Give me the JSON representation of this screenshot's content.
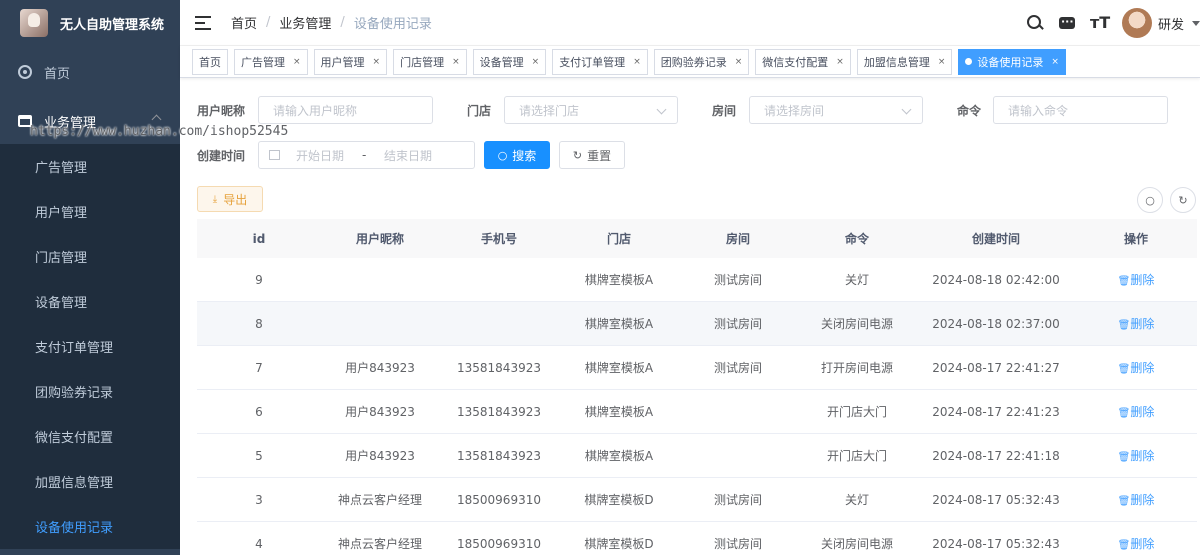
{
  "app": {
    "title": "无人自助管理系统"
  },
  "sidebar": {
    "home": "首页",
    "group": "业务管理",
    "items": [
      {
        "label": "广告管理",
        "active": false
      },
      {
        "label": "用户管理",
        "active": false
      },
      {
        "label": "门店管理",
        "active": false
      },
      {
        "label": "设备管理",
        "active": false
      },
      {
        "label": "支付订单管理",
        "active": false
      },
      {
        "label": "团购验券记录",
        "active": false
      },
      {
        "label": "微信支付配置",
        "active": false
      },
      {
        "label": "加盟信息管理",
        "active": false
      },
      {
        "label": "设备使用记录",
        "active": true
      }
    ]
  },
  "watermark": "https://www.huzhan.com/ishop52545",
  "breadcrumb": [
    "首页",
    "业务管理",
    "设备使用记录"
  ],
  "user": {
    "name": "研发"
  },
  "navbar": {
    "size_icon": "тT"
  },
  "tags": [
    {
      "label": "首页",
      "closable": false,
      "active": false
    },
    {
      "label": "广告管理",
      "closable": true,
      "active": false
    },
    {
      "label": "用户管理",
      "closable": true,
      "active": false
    },
    {
      "label": "门店管理",
      "closable": true,
      "active": false
    },
    {
      "label": "设备管理",
      "closable": true,
      "active": false
    },
    {
      "label": "支付订单管理",
      "closable": true,
      "active": false
    },
    {
      "label": "团购验券记录",
      "closable": true,
      "active": false
    },
    {
      "label": "微信支付配置",
      "closable": true,
      "active": false
    },
    {
      "label": "加盟信息管理",
      "closable": true,
      "active": false
    },
    {
      "label": "设备使用记录",
      "closable": true,
      "active": true
    }
  ],
  "form": {
    "nickname_label": "用户昵称",
    "nickname_placeholder": "请输入用户昵称",
    "store_label": "门店",
    "store_placeholder": "请选择门店",
    "room_label": "房间",
    "room_placeholder": "请选择房间",
    "command_label": "命令",
    "command_placeholder": "请输入命令",
    "created_label": "创建时间",
    "start_placeholder": "开始日期",
    "range_sep": "-",
    "end_placeholder": "结束日期",
    "search_label": "搜索",
    "reset_label": "重置",
    "export_label": "导出"
  },
  "table": {
    "columns": [
      "id",
      "用户昵称",
      "手机号",
      "门店",
      "房间",
      "命令",
      "创建时间",
      "操作"
    ],
    "delete_label": "删除",
    "rows": [
      {
        "id": "9",
        "nickname": "",
        "phone": "",
        "store": "棋牌室模板A",
        "room": "测试房间",
        "command": "关灯",
        "created": "2024-08-18 02:42:00",
        "hover": false
      },
      {
        "id": "8",
        "nickname": "",
        "phone": "",
        "store": "棋牌室模板A",
        "room": "测试房间",
        "command": "关闭房间电源",
        "created": "2024-08-18 02:37:00",
        "hover": true
      },
      {
        "id": "7",
        "nickname": "用户843923",
        "phone": "13581843923",
        "store": "棋牌室模板A",
        "room": "测试房间",
        "command": "打开房间电源",
        "created": "2024-08-17 22:41:27",
        "hover": false
      },
      {
        "id": "6",
        "nickname": "用户843923",
        "phone": "13581843923",
        "store": "棋牌室模板A",
        "room": "",
        "command": "开门店大门",
        "created": "2024-08-17 22:41:23",
        "hover": false
      },
      {
        "id": "5",
        "nickname": "用户843923",
        "phone": "13581843923",
        "store": "棋牌室模板A",
        "room": "",
        "command": "开门店大门",
        "created": "2024-08-17 22:41:18",
        "hover": false
      },
      {
        "id": "3",
        "nickname": "神点云客户经理",
        "phone": "18500969310",
        "store": "棋牌室模板D",
        "room": "测试房间",
        "command": "关灯",
        "created": "2024-08-17 05:32:43",
        "hover": false
      },
      {
        "id": "4",
        "nickname": "神点云客户经理",
        "phone": "18500969310",
        "store": "棋牌室模板D",
        "room": "测试房间",
        "command": "关闭房间电源",
        "created": "2024-08-17 05:32:43",
        "hover": false
      }
    ]
  },
  "colors": {
    "sidebar_bg": "#304156",
    "submenu_bg": "#1f2d3d",
    "primary": "#409eff",
    "warning": "#e6a23c"
  }
}
